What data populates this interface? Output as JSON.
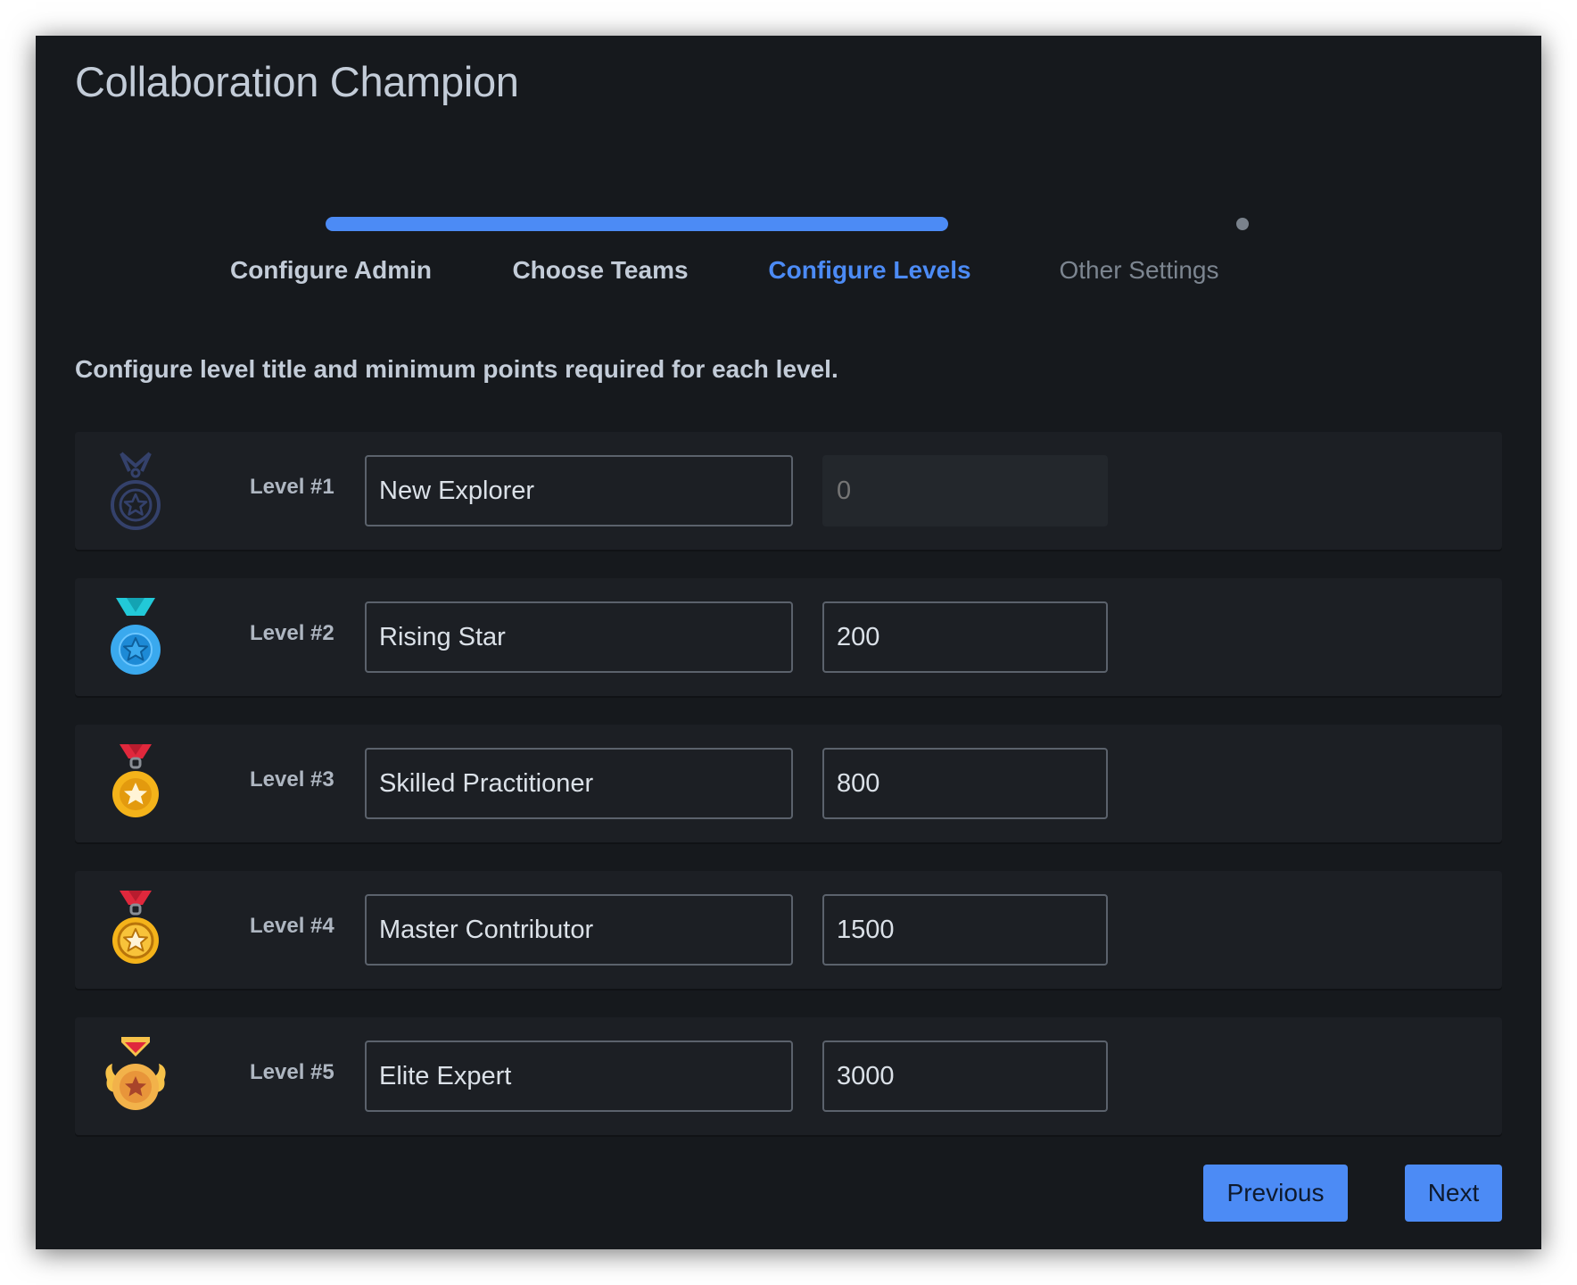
{
  "app": {
    "title": "Collaboration Champion"
  },
  "wizard": {
    "steps": [
      {
        "label": "Configure Admin",
        "state": "completed"
      },
      {
        "label": "Choose Teams",
        "state": "completed"
      },
      {
        "label": "Configure Levels",
        "state": "active"
      },
      {
        "label": "Other Settings",
        "state": "pending"
      }
    ],
    "progress_fraction": 0.67,
    "instruction": "Configure level title and minimum points required for each level."
  },
  "levels": [
    {
      "label": "Level #1",
      "title": "New Explorer",
      "points": "",
      "points_placeholder": "0",
      "points_disabled": true,
      "icon": "outline-star-medal-icon"
    },
    {
      "label": "Level #2",
      "title": "Rising Star",
      "points": "200",
      "points_disabled": false,
      "icon": "blue-star-medal-icon"
    },
    {
      "label": "Level #3",
      "title": "Skilled Practitioner",
      "points": "800",
      "points_disabled": false,
      "icon": "gold-star-medal-icon"
    },
    {
      "label": "Level #4",
      "title": "Master Contributor",
      "points": "1500",
      "points_disabled": false,
      "icon": "gold-outlined-star-medal-icon"
    },
    {
      "label": "Level #5",
      "title": "Elite Expert",
      "points": "3000",
      "points_disabled": false,
      "icon": "winged-bronze-medal-icon"
    }
  ],
  "footer": {
    "previous_label": "Previous",
    "next_label": "Next"
  },
  "colors": {
    "accent": "#4c8bf5",
    "background": "#16191d",
    "row_background": "#1c1f24"
  }
}
